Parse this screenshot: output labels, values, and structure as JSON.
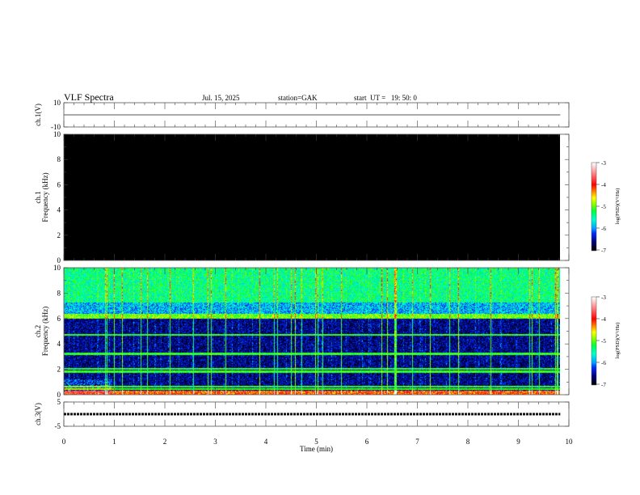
{
  "header": {
    "title": "VLF Spectra",
    "date": "Jul. 15, 2025",
    "station": "station=GAK",
    "start": "start  UT =   19: 50: 0"
  },
  "chart_data": {
    "type": "heatmap",
    "xlabel": "Time  (min)",
    "xlim": [
      0,
      10
    ],
    "xticks": [
      "0",
      "1",
      "2",
      "3",
      "4",
      "5",
      "6",
      "7",
      "8",
      "9",
      "10"
    ],
    "data_end_min": 9.83,
    "colorbar": {
      "label": "log(PSD)(V²/Hz)",
      "range": [
        -7,
        -3
      ],
      "ticks": [
        "-3",
        "-4",
        "-5",
        "-6",
        "-7"
      ],
      "colormap": [
        "#000000",
        "#000080",
        "#0030ff",
        "#00a0ff",
        "#00ffd0",
        "#00ff40",
        "#60ff00",
        "#ffff00",
        "#ff8000",
        "#ff0000",
        "#ff8080",
        "#ffffff"
      ]
    },
    "panels": [
      {
        "id": "ch1-waveform",
        "type": "line",
        "ylabel": "ch.1(V)",
        "ylim": [
          -10,
          10
        ],
        "yticks": [
          "10",
          "-10"
        ],
        "value": 0
      },
      {
        "id": "ch1-spectrogram",
        "type": "heatmap",
        "ylabel1": "ch.1",
        "ylabel2": "Frequency  (kHz)",
        "ylim": [
          0,
          10
        ],
        "yticks": [
          "0",
          "2",
          "4",
          "6",
          "8",
          "10"
        ],
        "level": -7
      },
      {
        "id": "ch2-spectrogram",
        "type": "heatmap",
        "ylabel1": "ch.2",
        "ylabel2": "Frequency  (kHz)",
        "ylim": [
          0,
          10
        ],
        "yticks": [
          "0",
          "2",
          "4",
          "6",
          "8",
          "10"
        ],
        "bands_khz": [
          {
            "range": [
              7.3,
              10
            ],
            "level": -5.4
          },
          {
            "range": [
              6.0,
              6.4
            ],
            "level": -5.0
          },
          {
            "range": [
              6.4,
              7.3
            ],
            "level": -5.9
          },
          {
            "range": [
              0.3,
              6.0
            ],
            "level": -6.6
          }
        ],
        "lines_khz": [
          6.1,
          4.7,
          3.2,
          2.0,
          1.8,
          0.6,
          0.4
        ]
      },
      {
        "id": "ch3-waveform",
        "type": "line",
        "ylabel": "ch.3(V)",
        "ylim": [
          -5,
          5
        ],
        "yticks": [
          "5",
          "-5"
        ],
        "value": 0
      }
    ]
  }
}
